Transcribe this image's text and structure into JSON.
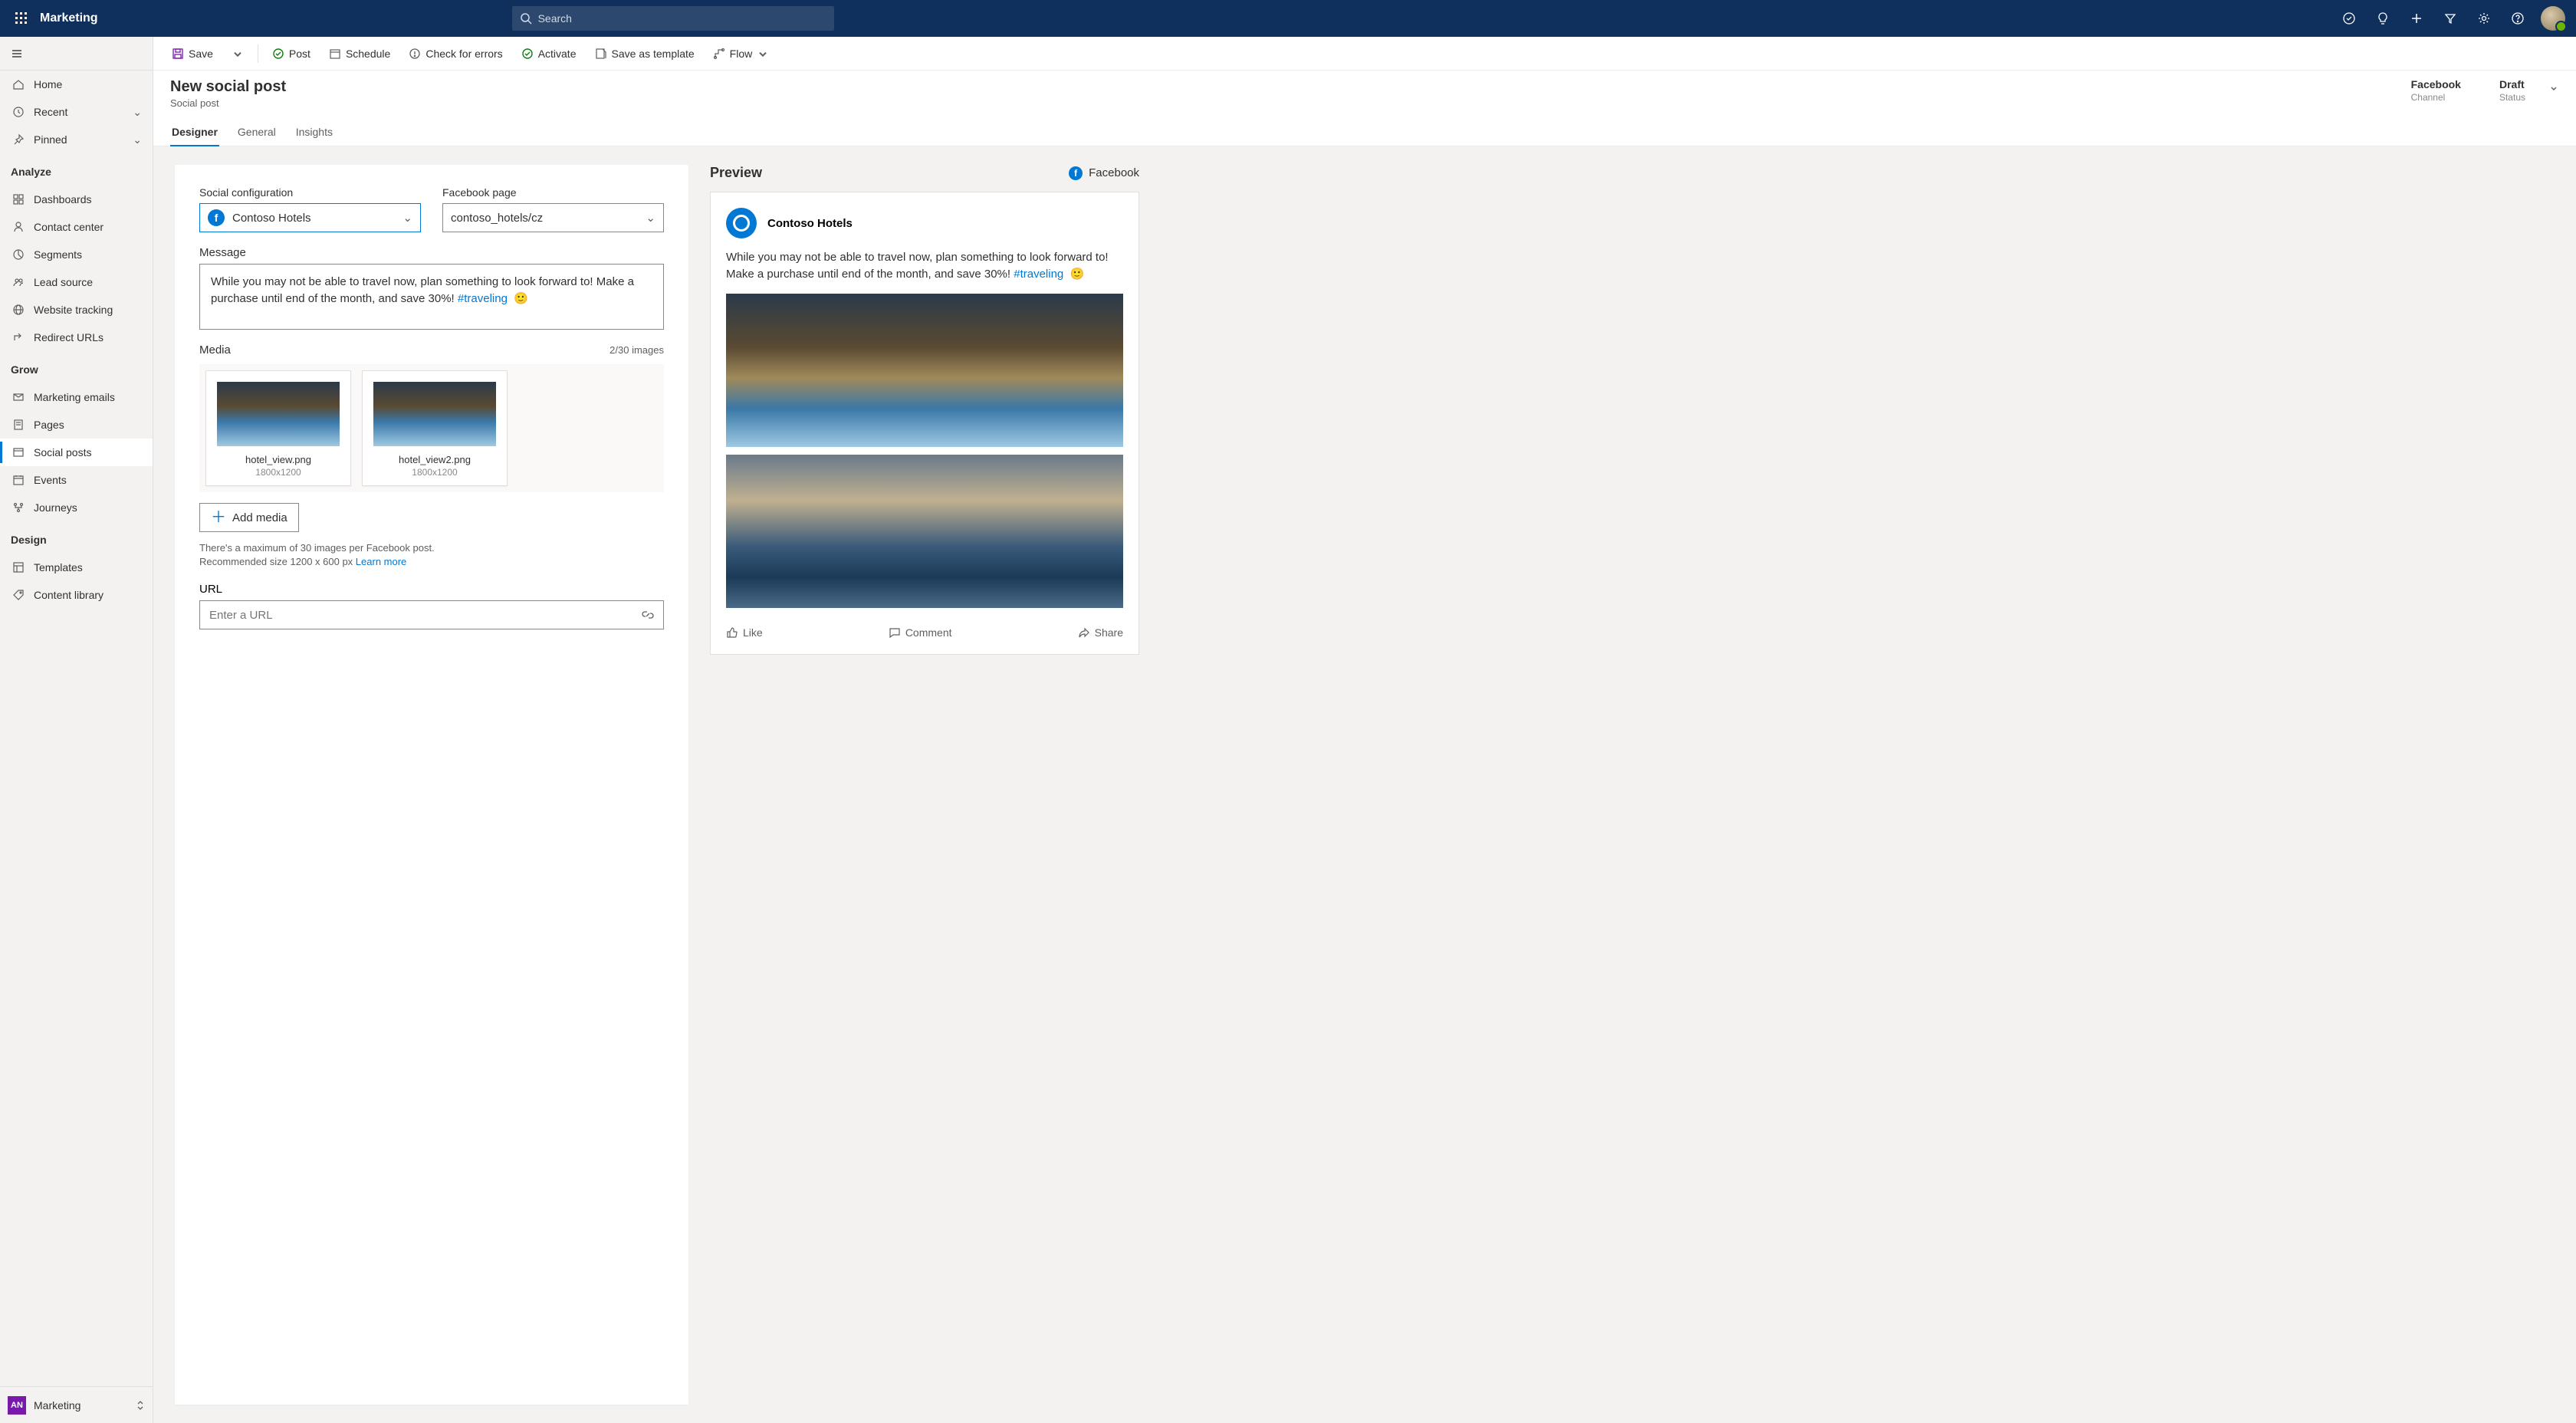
{
  "topbar": {
    "app_title": "Marketing",
    "search_placeholder": "Search"
  },
  "leftnav": {
    "home": "Home",
    "recent": "Recent",
    "pinned": "Pinned",
    "sections": {
      "analyze": "Analyze",
      "grow": "Grow",
      "design": "Design"
    },
    "items": {
      "dashboards": "Dashboards",
      "contact_center": "Contact center",
      "segments": "Segments",
      "lead_source": "Lead source",
      "website_tracking": "Website tracking",
      "redirect_urls": "Redirect URLs",
      "marketing_emails": "Marketing emails",
      "pages": "Pages",
      "social_posts": "Social posts",
      "events": "Events",
      "journeys": "Journeys",
      "templates": "Templates",
      "content_library": "Content library"
    },
    "footer_badge": "AN",
    "footer_label": "Marketing"
  },
  "cmdbar": {
    "save": "Save",
    "post": "Post",
    "schedule": "Schedule",
    "check": "Check for errors",
    "activate": "Activate",
    "save_as_template": "Save as template",
    "flow": "Flow"
  },
  "header": {
    "title": "New social post",
    "subtitle": "Social post",
    "channel_value": "Facebook",
    "channel_label": "Channel",
    "status_value": "Draft",
    "status_label": "Status"
  },
  "tabs": {
    "designer": "Designer",
    "general": "General",
    "insights": "Insights"
  },
  "form": {
    "social_config_label": "Social configuration",
    "social_config_value": "Contoso Hotels",
    "page_label": "Facebook page",
    "page_value": "contoso_hotels/cz",
    "message_label": "Message",
    "message_text": "While you may not be able to travel now, plan something to look forward to! Make a purchase until end of the month, and save 30%! ",
    "message_tag": "#traveling",
    "message_emoji": "🙂",
    "media_label": "Media",
    "media_count": "2/30 images",
    "media": [
      {
        "filename": "hotel_view.png",
        "dims": "1800x1200"
      },
      {
        "filename": "hotel_view2.png",
        "dims": "1800x1200"
      }
    ],
    "add_media": "Add media",
    "hint1": "There's a maximum of 30 images per Facebook post.",
    "hint2": "Recommended size 1200 x 600 px ",
    "learn_more": "Learn more",
    "url_label": "URL",
    "url_placeholder": "Enter a URL"
  },
  "preview": {
    "title": "Preview",
    "channel": "Facebook",
    "account": "Contoso Hotels",
    "text": "While you may not be able to travel now, plan something to look forward to! Make a purchase until end of the month, and save 30%! ",
    "tag": "#traveling",
    "emoji": "🙂",
    "like": "Like",
    "comment": "Comment",
    "share": "Share"
  }
}
